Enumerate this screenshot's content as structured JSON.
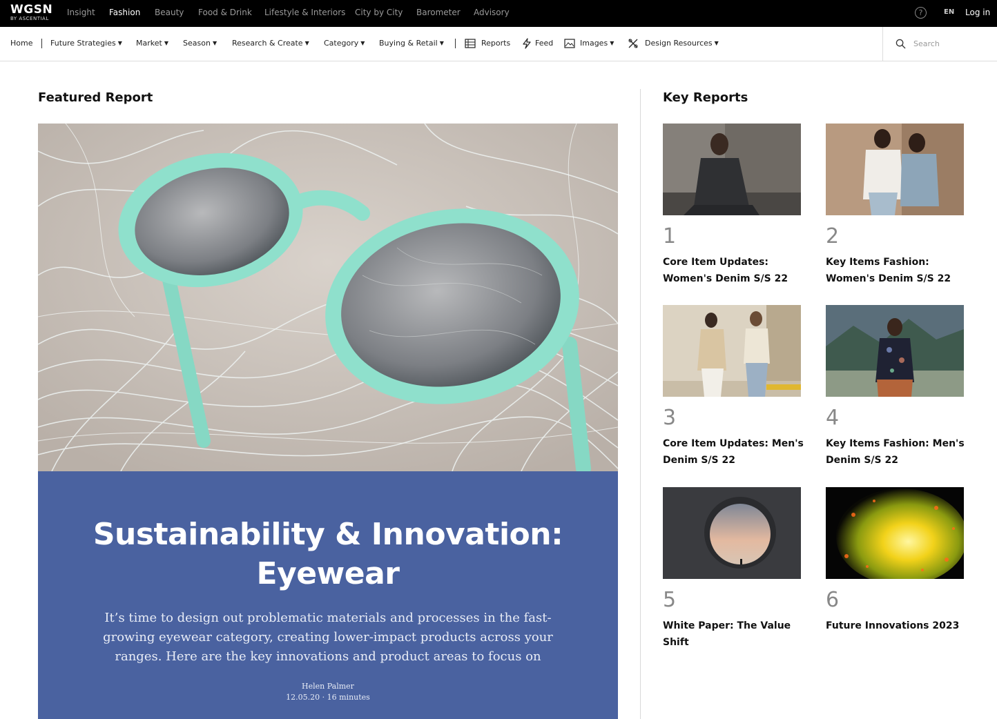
{
  "brand": {
    "logo": "WGSN",
    "logo_sub": "BY ASCENTIAL"
  },
  "topnav": [
    {
      "label": "Insight",
      "active": false
    },
    {
      "label": "Fashion",
      "active": true
    },
    {
      "label": "Beauty",
      "active": false
    },
    {
      "label": "Food & Drink",
      "active": false
    },
    {
      "label": "Lifestyle & Interiors",
      "active": false
    },
    {
      "label": "City by City",
      "active": false
    },
    {
      "label": "Barometer",
      "active": false
    },
    {
      "label": "Advisory",
      "active": false
    }
  ],
  "topright": {
    "help": "?",
    "lang": "EN",
    "login": "Log in"
  },
  "subnav": {
    "home": "Home",
    "future_strategies": "Future Strategies",
    "market": "Market",
    "season": "Season",
    "research_create": "Research & Create",
    "category": "Category",
    "buying_retail": "Buying & Retail",
    "reports": "Reports",
    "feed": "Feed",
    "images": "Images",
    "design_resources": "Design Resources",
    "caret": "▼"
  },
  "search": {
    "placeholder": "Search"
  },
  "featured": {
    "section_title": "Featured Report",
    "title_line1": "Sustainability & Innovation:",
    "title_line2": "Eyewear",
    "description": "It’s time to design out problematic materials and processes in the fast-growing eyewear category, creating lower-impact products across your ranges. Here are the key innovations and product areas to focus on",
    "author": "Helen Palmer",
    "meta": "12.05.20 · 16 minutes"
  },
  "key_reports": {
    "section_title": "Key Reports",
    "items": [
      {
        "num": "1",
        "title": "Core Item Updates: Women's Denim S/S 22"
      },
      {
        "num": "2",
        "title": "Key Items Fashion: Women's Denim S/S 22"
      },
      {
        "num": "3",
        "title": "Core Item Updates: Men's Denim S/S 22"
      },
      {
        "num": "4",
        "title": "Key Items Fashion: Men's Denim S/S 22"
      },
      {
        "num": "5",
        "title": "White Paper: The Value Shift"
      },
      {
        "num": "6",
        "title": "Future Innovations 2023"
      }
    ]
  },
  "colors": {
    "topbar": "#000000",
    "featured_panel": "#4a62a0",
    "frame_mint": "#8fe0cc"
  }
}
